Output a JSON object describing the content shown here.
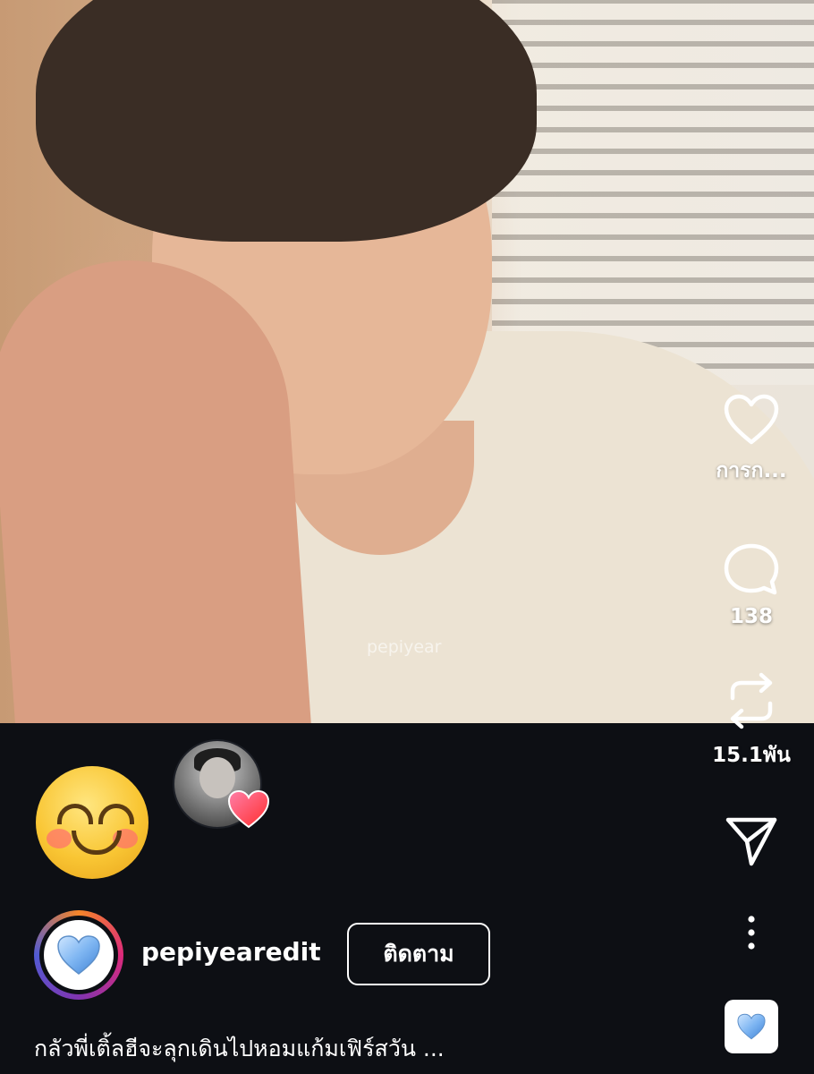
{
  "video": {
    "watermark": "pepiyear"
  },
  "actions": {
    "like": {
      "label": "การก...",
      "icon": "heart-outline-icon"
    },
    "comment": {
      "label": "138",
      "icon": "comment-bubble-icon"
    },
    "repost": {
      "label": "15.1พัน",
      "icon": "repost-icon"
    },
    "share": {
      "icon": "send-icon"
    },
    "more": {
      "icon": "more-vertical-icon"
    }
  },
  "reactions": {
    "emoji": "smiling-face-emoji",
    "reply_avatar_badge": "heart-icon"
  },
  "post": {
    "username": "pepiyearedit",
    "follow_label": "ติดตาม",
    "caption": "กลัวพี่เติ้ลฮีจะลุกเดินไปหอมแก้มเฟิร์สวัน ...",
    "avatar_icon": "blue-heart-icon",
    "audio_icon": "blue-heart-icon"
  },
  "colors": {
    "background": "#0d0f14",
    "text": "#ffffff",
    "story_ring": [
      "#f58529",
      "#dd2a7b",
      "#8134af",
      "#515bd4"
    ],
    "heart_blue": "#7fb6f2"
  }
}
